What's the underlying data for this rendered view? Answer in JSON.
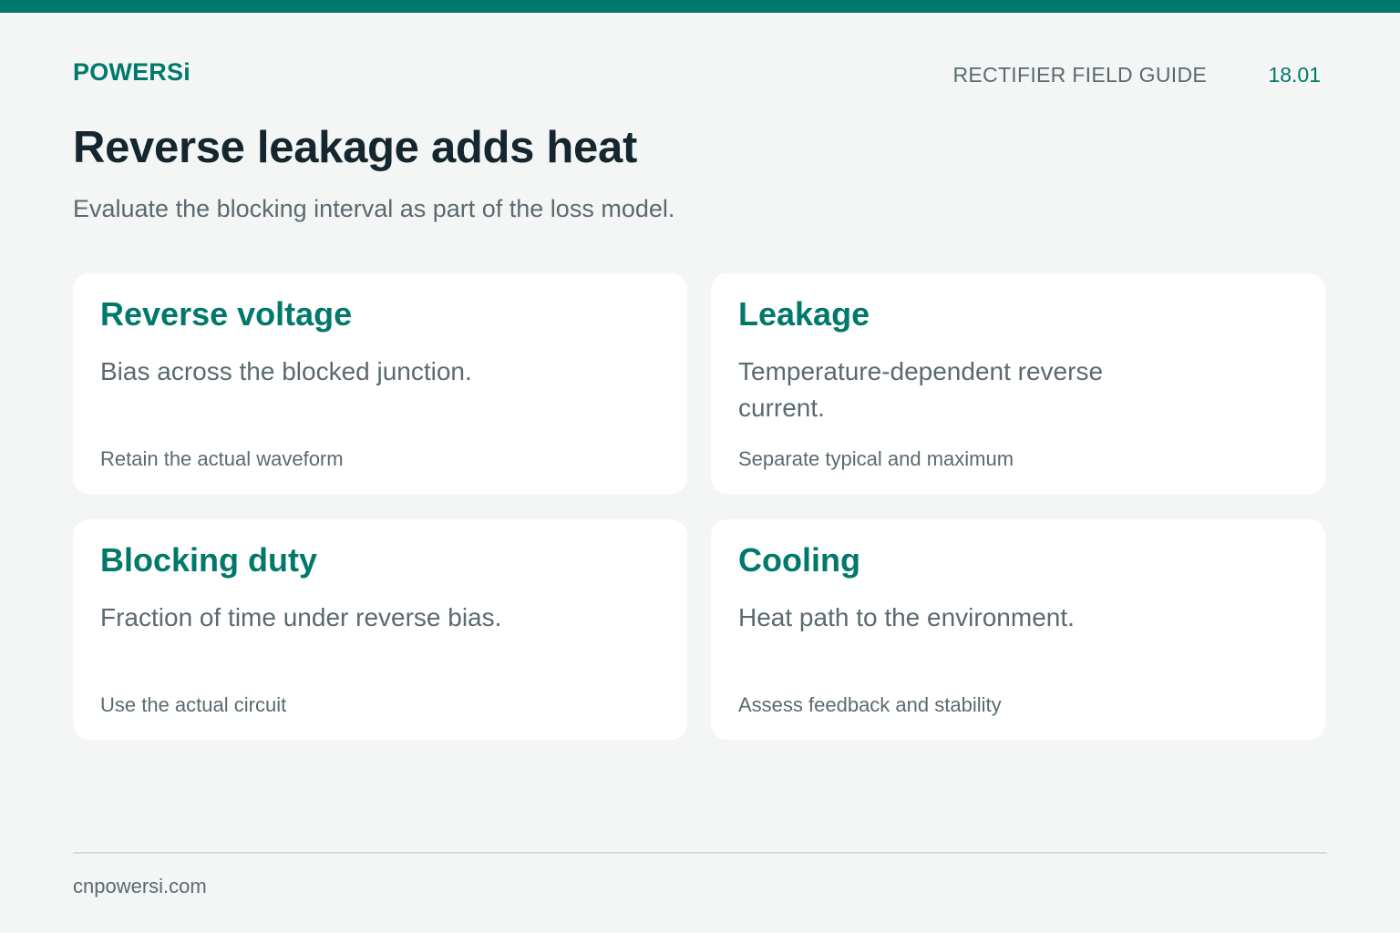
{
  "header": {
    "brand": "POWERSi",
    "guide_label": "RECTIFIER FIELD GUIDE",
    "page_number": "18.01"
  },
  "title": "Reverse leakage adds heat",
  "subtitle": "Evaluate the blocking interval as part of the loss model.",
  "cards": [
    {
      "title": "Reverse voltage",
      "description": "Bias across the blocked junction.",
      "note": "Retain the actual waveform"
    },
    {
      "title": "Leakage",
      "description": "Temperature-dependent reverse current.",
      "note": "Separate typical and maximum"
    },
    {
      "title": "Blocking duty",
      "description": "Fraction of time under reverse bias.",
      "note": "Use the actual circuit"
    },
    {
      "title": "Cooling",
      "description": "Heat path to the environment.",
      "note": "Assess feedback and stability"
    }
  ],
  "footer": {
    "site": "cnpowersi.com"
  },
  "colors": {
    "accent": "#00796b",
    "background": "#f4f6f5",
    "title_text": "#14262e",
    "body_text": "#5a6a70"
  }
}
